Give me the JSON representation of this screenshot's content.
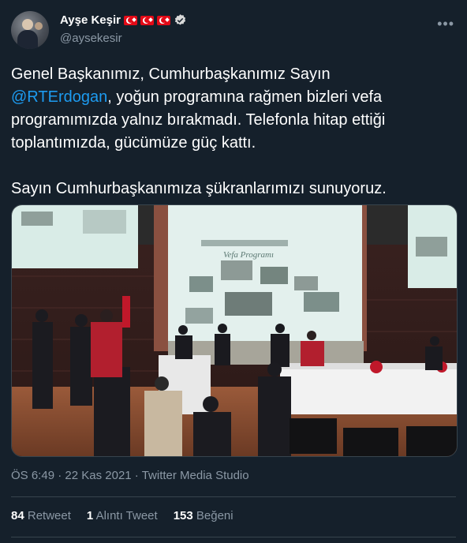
{
  "author": {
    "name": "Ayşe Keşir",
    "handle": "@aysekesir",
    "flags": [
      "flag-turkey",
      "flag-turkey",
      "flag-turkey"
    ],
    "verified_icon": "verified-badge-icon",
    "accent_color": "#1d9bf0"
  },
  "tweet": {
    "line1": "Genel Başkanımız, Cumhurbaşkanımız Sayın",
    "mention": "@RTErdogan",
    "line2_rest": ", yoğun programına rağmen bizleri vefa",
    "line3": "programımızda yalnız bırakmadı. Telefonla hitap ettiği",
    "line4": "toplantımızda, gücümüze güç kattı.",
    "line5": "Sayın Cumhurbaşkanımıza şükranlarımızı sunuyoruz."
  },
  "media": {
    "screen_title": "Vefa Programı"
  },
  "meta": {
    "time": "ÖS 6:49",
    "separator": " · ",
    "date": "22 Kas 2021",
    "source": "Twitter Media Studio"
  },
  "stats": {
    "retweets_count": "84",
    "retweets_label": "Retweet",
    "quotes_count": "1",
    "quotes_label": "Alıntı Tweet",
    "likes_count": "153",
    "likes_label": "Beğeni"
  }
}
